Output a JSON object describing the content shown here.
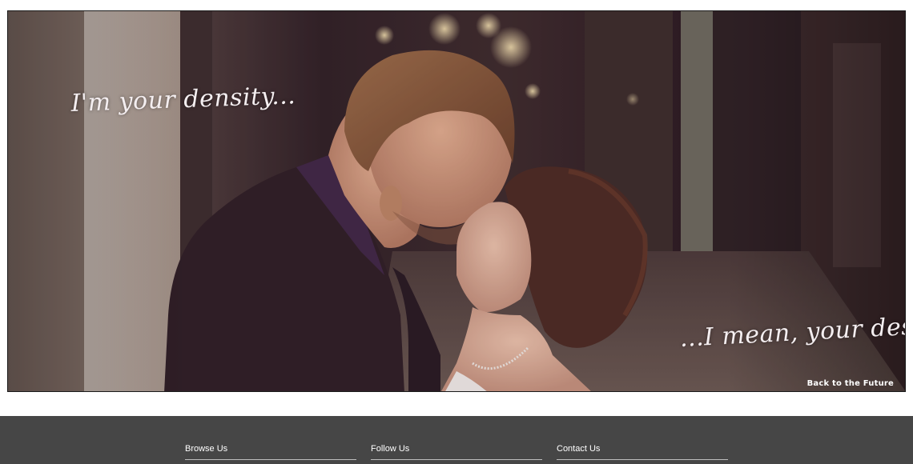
{
  "hero": {
    "quote_left": "I'm your density...",
    "quote_right": "...I mean, your destiny",
    "caption": "Back to the Future"
  },
  "footer": {
    "columns": [
      {
        "label": "Browse Us"
      },
      {
        "label": "Follow Us"
      },
      {
        "label": "Contact Us"
      }
    ]
  },
  "colors": {
    "footer_bg": "#464646",
    "page_bg": "#ffffff",
    "overlay_text": "#f4eef0"
  }
}
